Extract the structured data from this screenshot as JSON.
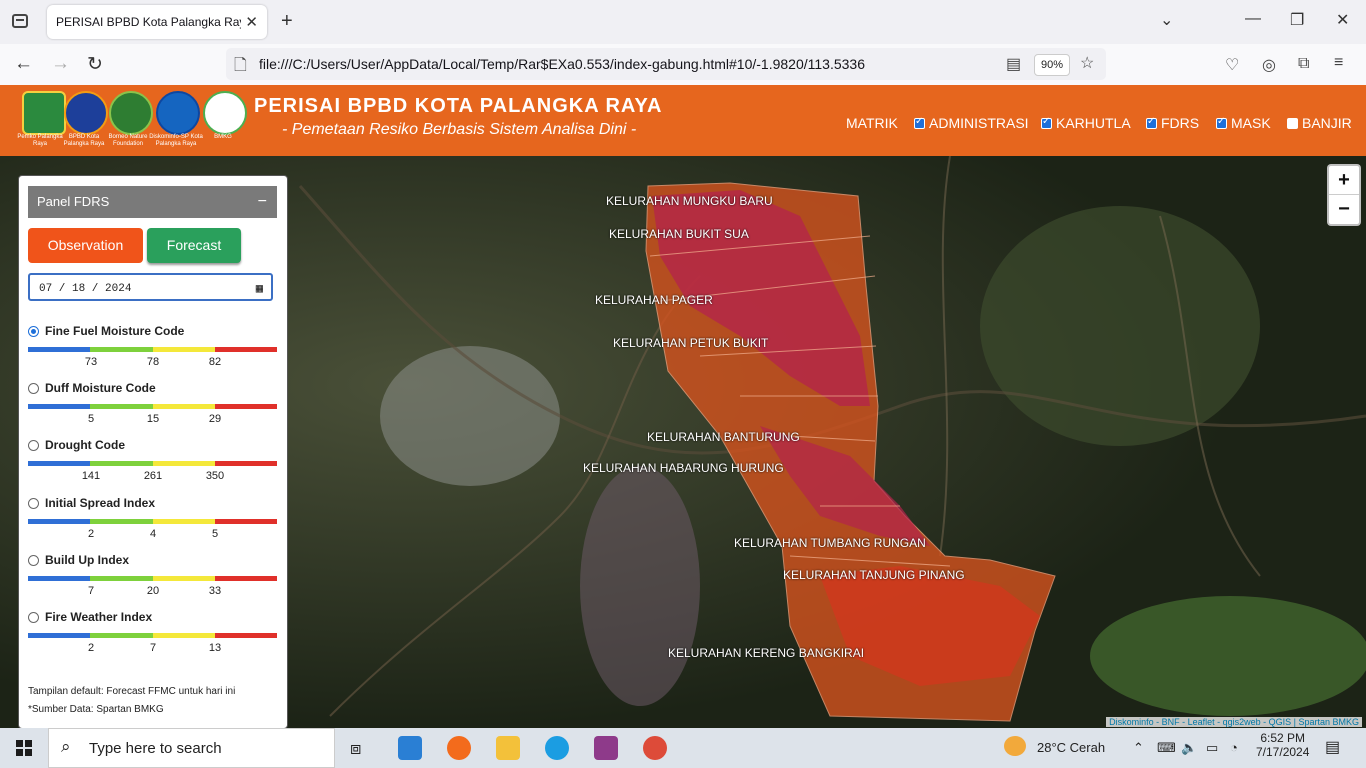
{
  "browser": {
    "tab_title": "PERISAI BPBD Kota Palangka Raya",
    "url": "file:///C:/Users/User/AppData/Local/Temp/Rar$EXa0.553/index-gabung.html#10/-1.9820/113.5336",
    "zoom": "90%"
  },
  "header": {
    "title": "PERISAI BPBD KOTA PALANGKA RAYA",
    "subtitle": "- Pemetaan Resiko Berbasis Sistem Analisa Dini -",
    "logos": [
      {
        "caption": "Pemko Palangka Raya"
      },
      {
        "caption": "BPBD Kota Palangka Raya"
      },
      {
        "caption": "Borneo Nature Foundation"
      },
      {
        "caption": "Diskominfo-SP Kota Palangka Raya"
      },
      {
        "caption": "BMKG"
      }
    ],
    "menu": [
      {
        "label": "MATRIK",
        "checkbox": null
      },
      {
        "label": "ADMINISTRASI",
        "checkbox": true
      },
      {
        "label": "KARHUTLA",
        "checkbox": true
      },
      {
        "label": "FDRS",
        "checkbox": true
      },
      {
        "label": "MASK",
        "checkbox": true
      },
      {
        "label": "BANJIR",
        "checkbox": false
      }
    ]
  },
  "panel": {
    "title": "Panel FDRS",
    "minimize": "−",
    "observation_label": "Observation",
    "forecast_label": "Forecast",
    "date_value": "07 / 18 / 2024",
    "scale_colors": [
      "#2f6fd6",
      "#7ed13c",
      "#f4e83a",
      "#e0302a"
    ],
    "indices": [
      {
        "label": "Fine Fuel Moisture Code",
        "selected": true,
        "ticks": [
          "73",
          "78",
          "82"
        ]
      },
      {
        "label": "Duff Moisture Code",
        "selected": false,
        "ticks": [
          "5",
          "15",
          "29"
        ]
      },
      {
        "label": "Drought Code",
        "selected": false,
        "ticks": [
          "141",
          "261",
          "350"
        ]
      },
      {
        "label": "Initial Spread Index",
        "selected": false,
        "ticks": [
          "2",
          "4",
          "5"
        ]
      },
      {
        "label": "Build Up Index",
        "selected": false,
        "ticks": [
          "7",
          "20",
          "33"
        ]
      },
      {
        "label": "Fire Weather Index",
        "selected": false,
        "ticks": [
          "2",
          "7",
          "13"
        ]
      }
    ],
    "note1": "Tampilan default: Forecast FFMC untuk hari ini",
    "note2": "*Sumber Data: Spartan BMKG"
  },
  "map": {
    "labels": [
      "KELURAHAN MUNGKU BARU",
      "KELURAHAN BUKIT SUA",
      "KELURAHAN PAGER",
      "KELURAHAN PETUK BUKIT",
      "KELURAHAN BANTURUNG",
      "KELURAHAN HABARUNG HURUNG",
      "KELURAHAN TUMBANG RUNGAN",
      "KELURAHAN TANJUNG PINANG",
      "KELURAHAN KERENG BANGKIRAI"
    ],
    "zoom_in": "+",
    "zoom_out": "−",
    "attribution": "Diskominfo - BNF - Leaflet - qgis2web - QGIS | Spartan BMKG",
    "region_colors": {
      "high": "#e05020",
      "extreme": "#b0204a"
    }
  },
  "taskbar": {
    "search_placeholder": "Type here to search",
    "weather": "28°C  Cerah",
    "time": "6:52 PM",
    "date": "7/17/2024"
  }
}
